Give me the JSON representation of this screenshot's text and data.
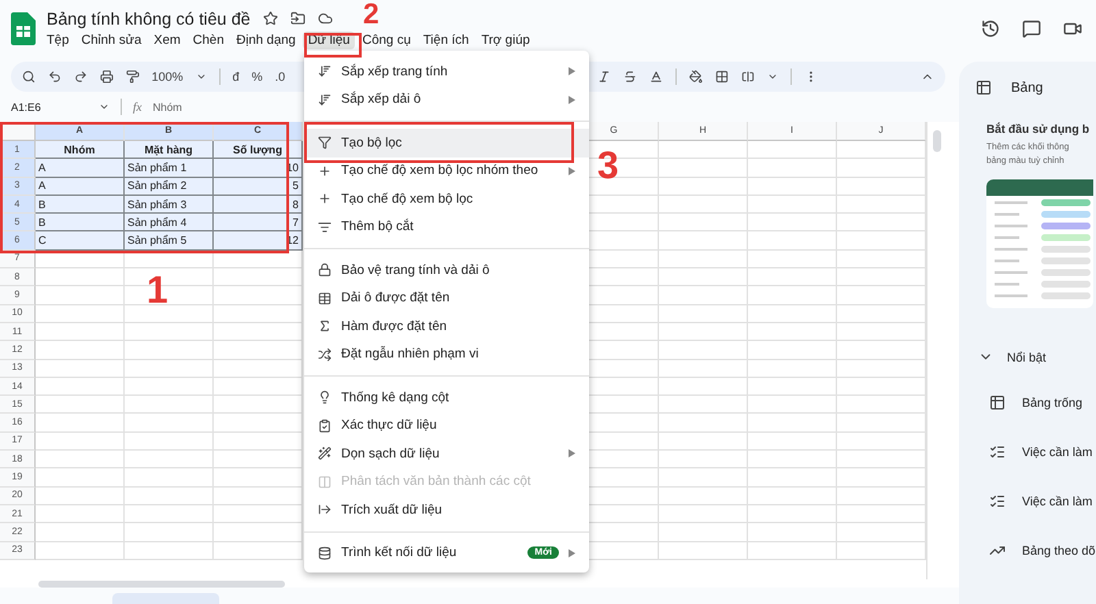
{
  "document": {
    "title": "Bảng tính không có tiêu đề"
  },
  "menubar": [
    {
      "label": "Tệp",
      "selected": false
    },
    {
      "label": "Chỉnh sửa",
      "selected": false
    },
    {
      "label": "Xem",
      "selected": false
    },
    {
      "label": "Chèn",
      "selected": false
    },
    {
      "label": "Định dạng",
      "selected": false
    },
    {
      "label": "Dữ liệu",
      "selected": true
    },
    {
      "label": "Công cụ",
      "selected": false
    },
    {
      "label": "Tiện ích",
      "selected": false
    },
    {
      "label": "Trợ giúp",
      "selected": false
    }
  ],
  "toolbar": {
    "zoom": "100%",
    "currency": "đ",
    "percent": "%",
    "decimal": ".0"
  },
  "formula_bar": {
    "name_box": "A1:E6",
    "fx": "fx",
    "content": "Nhóm"
  },
  "sheet": {
    "columns_left": [
      {
        "label": "A",
        "selected": true
      },
      {
        "label": "B",
        "selected": true
      },
      {
        "label": "C",
        "selected": true
      }
    ],
    "columns_right": [
      {
        "label": "G",
        "selected": false
      },
      {
        "label": "H",
        "selected": false
      },
      {
        "label": "I",
        "selected": false
      },
      {
        "label": "J",
        "selected": false
      }
    ],
    "rows": [
      {
        "number": "1",
        "selected": true,
        "kind": "header",
        "cells": [
          "Nhóm",
          "Mặt hàng",
          "Số lượng"
        ]
      },
      {
        "number": "2",
        "selected": true,
        "kind": "data",
        "cells": [
          "A",
          "Sản phẩm 1",
          "10"
        ]
      },
      {
        "number": "3",
        "selected": true,
        "kind": "data",
        "cells": [
          "A",
          "Sản phẩm 2",
          "5"
        ]
      },
      {
        "number": "4",
        "selected": true,
        "kind": "data",
        "cells": [
          "B",
          "Sản phẩm 3",
          "8"
        ]
      },
      {
        "number": "5",
        "selected": true,
        "kind": "data",
        "cells": [
          "B",
          "Sản phẩm 4",
          "7"
        ]
      },
      {
        "number": "6",
        "selected": true,
        "kind": "data",
        "cells": [
          "C",
          "Sản phẩm 5",
          "12"
        ]
      },
      {
        "number": "7",
        "selected": false,
        "kind": "empty"
      },
      {
        "number": "8",
        "selected": false,
        "kind": "empty"
      },
      {
        "number": "9",
        "selected": false,
        "kind": "empty"
      },
      {
        "number": "10",
        "selected": false,
        "kind": "empty"
      },
      {
        "number": "11",
        "selected": false,
        "kind": "empty"
      },
      {
        "number": "12",
        "selected": false,
        "kind": "empty"
      },
      {
        "number": "13",
        "selected": false,
        "kind": "empty"
      },
      {
        "number": "14",
        "selected": false,
        "kind": "empty"
      },
      {
        "number": "15",
        "selected": false,
        "kind": "empty"
      },
      {
        "number": "16",
        "selected": false,
        "kind": "empty"
      },
      {
        "number": "17",
        "selected": false,
        "kind": "empty"
      },
      {
        "number": "18",
        "selected": false,
        "kind": "empty"
      },
      {
        "number": "19",
        "selected": false,
        "kind": "empty"
      },
      {
        "number": "20",
        "selected": false,
        "kind": "empty"
      },
      {
        "number": "21",
        "selected": false,
        "kind": "empty"
      },
      {
        "number": "22",
        "selected": false,
        "kind": "empty"
      },
      {
        "number": "23",
        "selected": false,
        "kind": "empty"
      }
    ]
  },
  "data_menu": {
    "groups": [
      {
        "items": [
          {
            "label": "Sắp xếp trang tính",
            "submenu": true,
            "disabled": false,
            "selected": false
          },
          {
            "label": "Sắp xếp dải ô",
            "submenu": true,
            "disabled": false,
            "selected": false
          }
        ]
      },
      {
        "items": [
          {
            "label": "Tạo bộ lọc",
            "submenu": false,
            "disabled": false,
            "selected": true
          },
          {
            "label": "Tạo chế độ xem bộ lọc nhóm theo",
            "submenu": true,
            "disabled": false,
            "selected": false
          },
          {
            "label": "Tạo chế độ xem bộ lọc",
            "submenu": false,
            "disabled": false,
            "selected": false
          },
          {
            "label": "Thêm bộ cắt",
            "submenu": false,
            "disabled": false,
            "selected": false
          }
        ]
      },
      {
        "items": [
          {
            "label": "Bảo vệ trang tính và dải ô",
            "submenu": false,
            "disabled": false,
            "selected": false
          },
          {
            "label": "Dải ô được đặt tên",
            "submenu": false,
            "disabled": false,
            "selected": false
          },
          {
            "label": "Hàm được đặt tên",
            "submenu": false,
            "disabled": false,
            "selected": false
          },
          {
            "label": "Đặt ngẫu nhiên phạm vi",
            "submenu": false,
            "disabled": false,
            "selected": false
          }
        ]
      },
      {
        "items": [
          {
            "label": "Thống kê dạng cột",
            "submenu": false,
            "disabled": false,
            "selected": false
          },
          {
            "label": "Xác thực dữ liệu",
            "submenu": false,
            "disabled": false,
            "selected": false
          },
          {
            "label": "Dọn sạch dữ liệu",
            "submenu": true,
            "disabled": false,
            "selected": false
          },
          {
            "label": "Phân tách văn bản thành các cột",
            "submenu": false,
            "disabled": true,
            "selected": false
          },
          {
            "label": "Trích xuất dữ liệu",
            "submenu": false,
            "disabled": false,
            "selected": false
          }
        ]
      },
      {
        "items": [
          {
            "label": "Trình kết nối dữ liệu",
            "submenu": true,
            "disabled": false,
            "selected": false,
            "badge": "Mới"
          }
        ]
      }
    ]
  },
  "side_panel": {
    "title": "Bảng",
    "intro_title": "Bắt đầu sử dụng b",
    "intro_lines": [
      "Thêm các khối thông",
      "bảng màu tuỳ chỉnh"
    ],
    "section": {
      "label": "Nổi bật",
      "expanded": true
    },
    "templates": [
      "Bảng trống",
      "Việc cần làm",
      "Việc cần làm",
      "Bảng theo dõ"
    ]
  },
  "annotations": [
    {
      "label": "1"
    },
    {
      "label": "2"
    },
    {
      "label": "3"
    }
  ]
}
